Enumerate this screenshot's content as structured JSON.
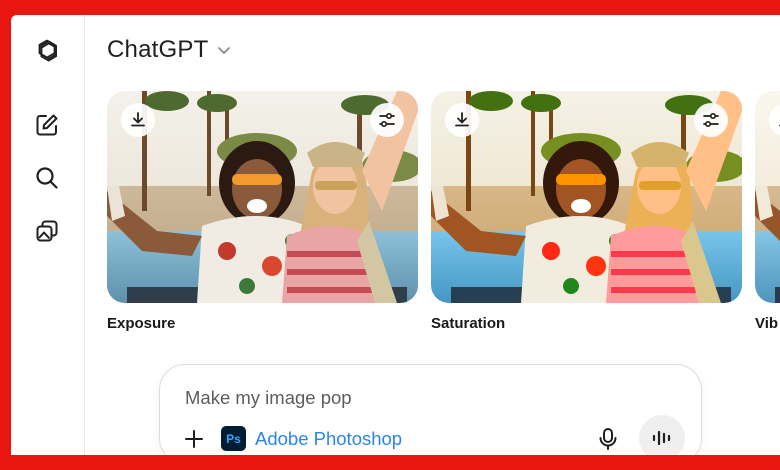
{
  "app": {
    "title": "ChatGPT"
  },
  "sidebar": {
    "items": [
      {
        "icon": "openai-logo-icon"
      },
      {
        "icon": "new-chat-icon"
      },
      {
        "icon": "search-icon"
      },
      {
        "icon": "library-icon"
      }
    ]
  },
  "cards": [
    {
      "label": "Exposure"
    },
    {
      "label": "Saturation"
    },
    {
      "label": "Vib"
    }
  ],
  "composer": {
    "prompt": "Make my image pop",
    "tool_badge": "Ps",
    "tool_name": "Adobe Photoshop"
  },
  "colors": {
    "frame": "#e8160f",
    "tool_link": "#2a84f0",
    "photoshop_bg": "#001d34",
    "photoshop_fg": "#31a8ff"
  }
}
